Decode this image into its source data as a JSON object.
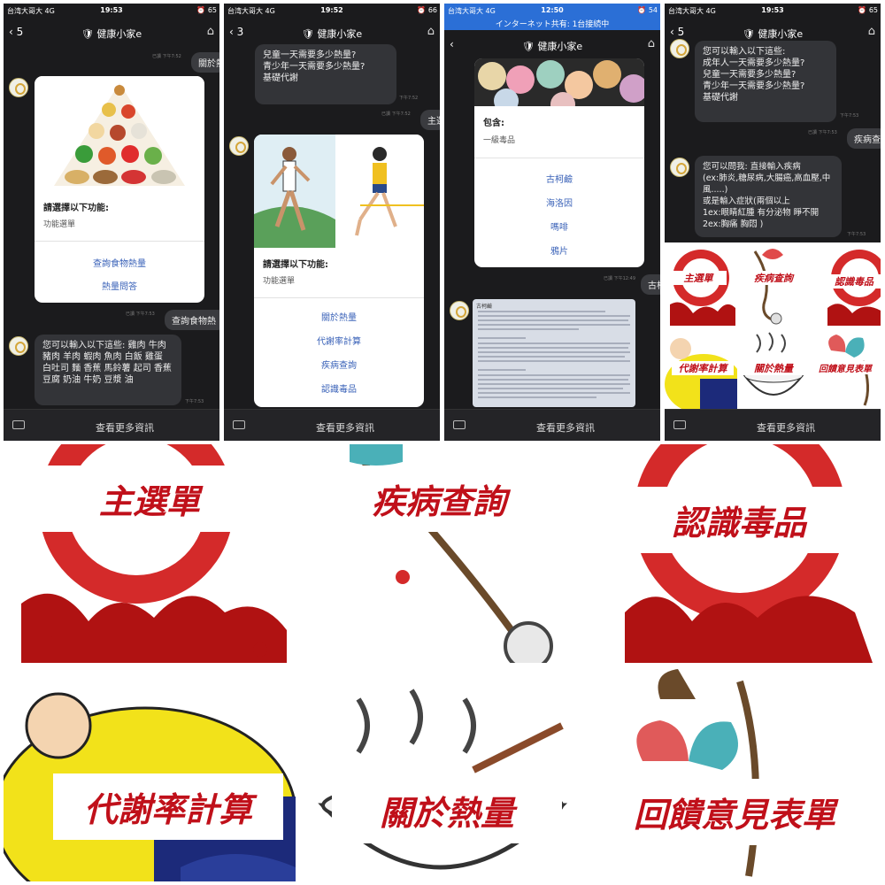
{
  "common": {
    "carrier": "台湾大哥大",
    "network": "4G",
    "bot_name": "健康小家e",
    "more_info": "查看更多資訊"
  },
  "phone1": {
    "time": "19:53",
    "battery": "65",
    "back_count": "5",
    "user_msg1": "關於熱",
    "ts1": "已讀\n下午7:52",
    "card_title": "請選擇以下功能:",
    "card_sub": "功能選單",
    "action1": "查詢食物熱量",
    "action2": "熱量問答",
    "user_msg2": "查詢食物熱",
    "ts2": "已讀\n下午7:53",
    "bot_msg": "您可以輸入以下這些: 雞肉 牛肉 豬肉 羊肉 蝦肉 魚肉 白飯 雞蛋 白吐司 麵 香蕉 馬鈴薯 起司 香蕉 豆腐 奶油 牛奶 豆漿 油",
    "ts3": "下午7:53"
  },
  "phone2": {
    "time": "19:52",
    "battery": "66",
    "back_count": "3",
    "bot_msg": "兒童一天需要多少熱量?\n青少年一天需要多少熱量?\n基礎代謝",
    "ts1": "下午7:52",
    "user_msg": "主選",
    "ts2": "已讀\n下午7:52",
    "card_title": "請選擇以下功能:",
    "card_sub": "功能選單",
    "actions": [
      "關於熱量",
      "代謝率計算",
      "疾病查詢",
      "認識毒品"
    ]
  },
  "phone3": {
    "time": "12:50",
    "battery": "54",
    "hotspot": "インターネット共有: 1台接続中",
    "card_title": "包含:",
    "card_sub": "一級毒品",
    "actions": [
      "古柯鹼",
      "海洛因",
      "嗎啡",
      "鴉片"
    ],
    "user_msg": "古柯",
    "ts1": "已讀\n下午12:49",
    "doc_title": "古柯鹼"
  },
  "phone4": {
    "time": "19:53",
    "battery": "65",
    "back_count": "5",
    "bot_msg1": "您可以輸入以下這些:\n 成年人一天需要多少熱量?\n 兒童一天需要多少熱量?\n 青少年一天需要多少熱量?\n 基礎代謝",
    "ts1": "下午7:53",
    "user_msg": "疾病查",
    "ts2": "已讀\n下午7:53",
    "bot_msg2": "您可以問我: 直接輸入疾病\n(ex:肺炎,糖尿病,大腸癌,高血壓,中風.....)\n或是輸入症狀(兩個以上\n1ex:眼睛紅腫 有分泌物 睜不開 2ex:胸痛 胸悶 )",
    "ts3": "下午7:53"
  },
  "menu": {
    "labels": [
      "主選單",
      "疾病查詢",
      "認識毒品",
      "代謝率計算",
      "關於熱量",
      "回饋意見表單"
    ]
  }
}
